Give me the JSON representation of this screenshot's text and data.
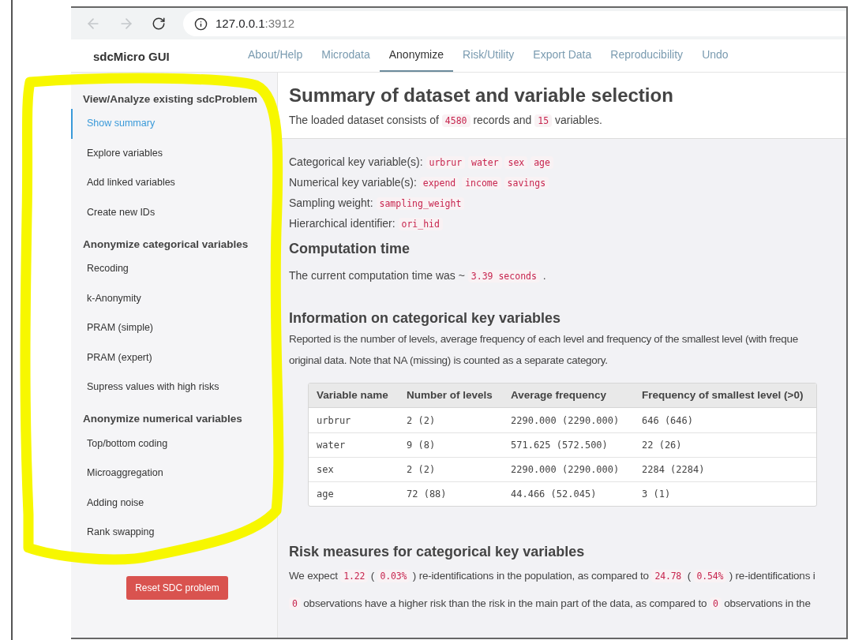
{
  "browser": {
    "host": "127.0.0.1",
    "port": ":3912"
  },
  "app": {
    "brand": "sdcMicro GUI",
    "tabs": [
      {
        "label": "About/Help",
        "selected": false
      },
      {
        "label": "Microdata",
        "selected": false
      },
      {
        "label": "Anonymize",
        "selected": true
      },
      {
        "label": "Risk/Utility",
        "selected": false
      },
      {
        "label": "Export Data",
        "selected": false
      },
      {
        "label": "Reproducibility",
        "selected": false
      },
      {
        "label": "Undo",
        "selected": false
      }
    ]
  },
  "sidebar": {
    "sections": [
      {
        "title": "View/Analyze existing sdcProblem",
        "items": [
          {
            "label": "Show summary",
            "selected": true
          },
          {
            "label": "Explore variables",
            "selected": false
          },
          {
            "label": "Add linked variables",
            "selected": false
          },
          {
            "label": "Create new IDs",
            "selected": false
          }
        ]
      },
      {
        "title": "Anonymize categorical variables",
        "items": [
          {
            "label": "Recoding",
            "selected": false
          },
          {
            "label": "k-Anonymity",
            "selected": false
          },
          {
            "label": "PRAM (simple)",
            "selected": false
          },
          {
            "label": "PRAM (expert)",
            "selected": false
          },
          {
            "label": "Supress values with high risks",
            "selected": false
          }
        ]
      },
      {
        "title": "Anonymize numerical variables",
        "items": [
          {
            "label": "Top/bottom coding",
            "selected": false
          },
          {
            "label": "Microaggregation",
            "selected": false
          },
          {
            "label": "Adding noise",
            "selected": false
          },
          {
            "label": "Rank swapping",
            "selected": false
          }
        ]
      }
    ],
    "reset_button": "Reset SDC problem"
  },
  "main": {
    "title": "Summary of dataset and variable selection",
    "intro": [
      {
        "kind": "text",
        "text": "The loaded dataset consists of "
      },
      {
        "kind": "code",
        "text": "4580"
      },
      {
        "kind": "text",
        "text": " records and "
      },
      {
        "kind": "code",
        "text": "15"
      },
      {
        "kind": "text",
        "text": " variables."
      }
    ],
    "key_lines": [
      [
        {
          "kind": "text",
          "text": "Categorical key variable(s): "
        },
        {
          "kind": "code",
          "text": "urbrur"
        },
        {
          "kind": "code",
          "text": "water"
        },
        {
          "kind": "code",
          "text": "sex"
        },
        {
          "kind": "code",
          "text": "age"
        }
      ],
      [
        {
          "kind": "text",
          "text": "Numerical key variable(s): "
        },
        {
          "kind": "code",
          "text": "expend"
        },
        {
          "kind": "code",
          "text": "income"
        },
        {
          "kind": "code",
          "text": "savings"
        }
      ],
      [
        {
          "kind": "text",
          "text": "Sampling weight: "
        },
        {
          "kind": "code",
          "text": "sampling_weight"
        }
      ],
      [
        {
          "kind": "text",
          "text": "Hierarchical identifier: "
        },
        {
          "kind": "code",
          "text": "ori_hid"
        }
      ]
    ],
    "computation": {
      "heading": "Computation time",
      "text": [
        {
          "kind": "text",
          "text": "The current computation time was ~ "
        },
        {
          "kind": "code",
          "text": "3.39 seconds"
        },
        {
          "kind": "text",
          "text": " ."
        }
      ]
    },
    "info": {
      "heading": "Information on categorical key variables",
      "lines": [
        "Reported is the number of levels, average frequency of each level and frequency of the smallest level (with freque",
        "original data. Note that NA (missing) is counted as a separate category."
      ],
      "table": {
        "columns": [
          "Variable name",
          "Number of levels",
          "Average frequency",
          "Frequency of smallest level (>0)"
        ],
        "rows": [
          [
            "urbrur",
            "2 (2)",
            "2290.000 (2290.000)",
            "646 (646)"
          ],
          [
            "water",
            "9 (8)",
            "571.625 (572.500)",
            "22 (26)"
          ],
          [
            "sex",
            "2 (2)",
            "2290.000 (2290.000)",
            "2284 (2284)"
          ],
          [
            "age",
            "72 (88)",
            "44.466 (52.045)",
            "3 (1)"
          ]
        ]
      }
    },
    "risk": {
      "heading": "Risk measures for categorical key variables",
      "lines": [
        [
          {
            "kind": "text",
            "text": "We expect "
          },
          {
            "kind": "code",
            "text": "1.22"
          },
          {
            "kind": "text",
            "text": " ( "
          },
          {
            "kind": "code",
            "text": "0.03%"
          },
          {
            "kind": "text",
            "text": " ) re-identifications in the population, as compared to "
          },
          {
            "kind": "code",
            "text": "24.78"
          },
          {
            "kind": "text",
            "text": " ( "
          },
          {
            "kind": "code",
            "text": "0.54%"
          },
          {
            "kind": "text",
            "text": " ) re-identifications i"
          }
        ],
        [
          {
            "kind": "code",
            "text": "0"
          },
          {
            "kind": "text",
            "text": " observations have a higher risk than the risk in the main part of the data, as compared to "
          },
          {
            "kind": "code",
            "text": "0"
          },
          {
            "kind": "text",
            "text": " observations in the"
          }
        ]
      ]
    }
  }
}
